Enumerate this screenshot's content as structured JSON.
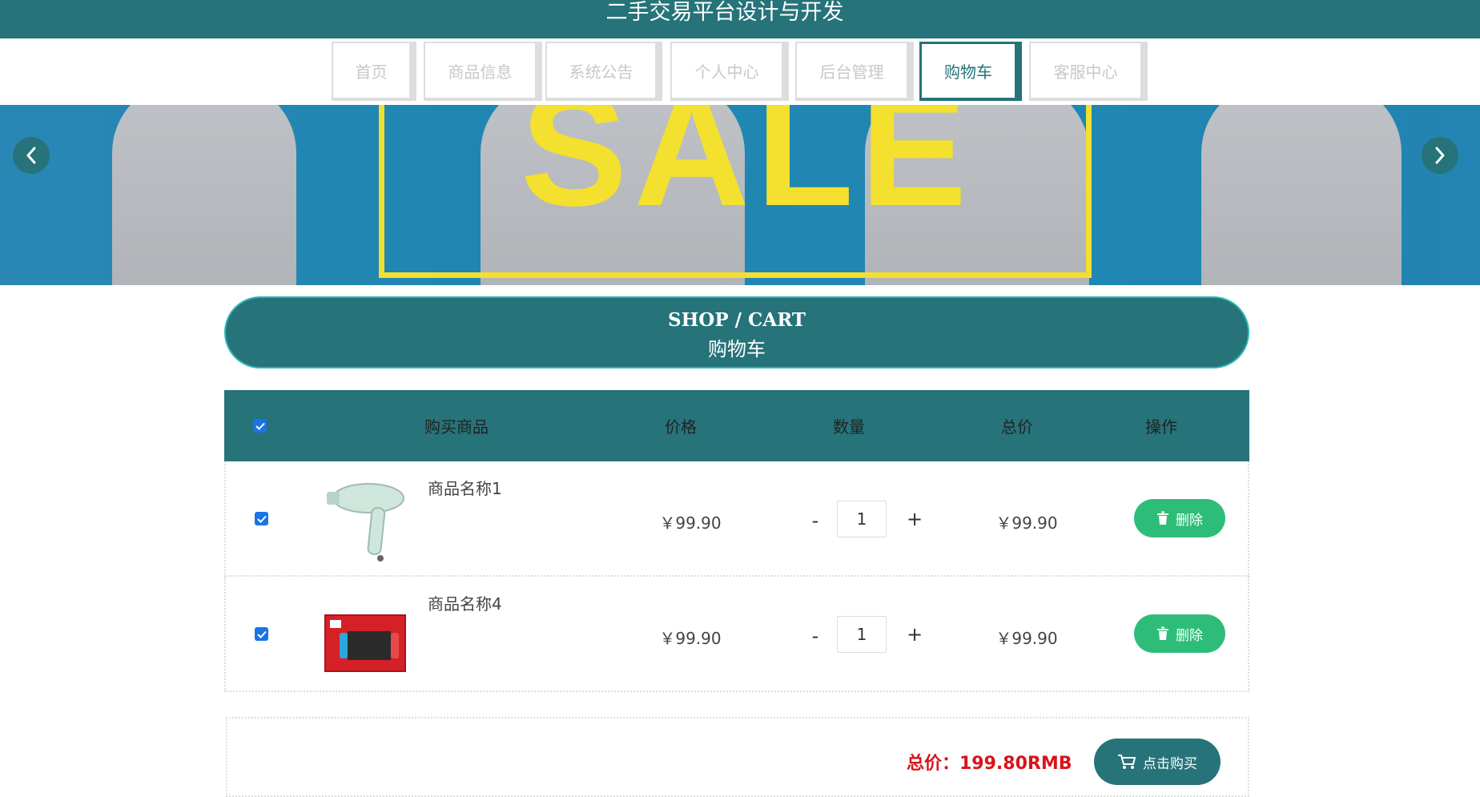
{
  "header": {
    "title": "二手交易平台设计与开发"
  },
  "nav": {
    "items": [
      {
        "label": "首页",
        "active": false
      },
      {
        "label": "商品信息",
        "active": false
      },
      {
        "label": "系统公告",
        "active": false
      },
      {
        "label": "个人中心",
        "active": false
      },
      {
        "label": "后台管理",
        "active": false
      },
      {
        "label": "购物车",
        "active": true
      },
      {
        "label": "客服中心",
        "active": false
      }
    ]
  },
  "banner": {
    "text": "SALE"
  },
  "section": {
    "title_en": "SHOP / CART",
    "title_cn": "购物车"
  },
  "table": {
    "select_all_checked": true,
    "headers": {
      "product": "购买商品",
      "price": "价格",
      "quantity": "数量",
      "total": "总价",
      "action": "操作"
    },
    "rows": [
      {
        "checked": true,
        "name": "商品名称1",
        "image": "hair-dryer",
        "price": "￥99.90",
        "minus": "-",
        "qty": "1",
        "plus": "+",
        "total": "￥99.90",
        "delete_label": "删除"
      },
      {
        "checked": true,
        "name": "商品名称4",
        "image": "game-console-box",
        "price": "￥99.90",
        "minus": "-",
        "qty": "1",
        "plus": "+",
        "total": "￥99.90",
        "delete_label": "删除"
      }
    ]
  },
  "summary": {
    "total_text": "总价：199.80RMB",
    "buy_label": "点击购买"
  },
  "colors": {
    "primary": "#26737a",
    "accent_border": "#2bb6b8",
    "delete_green": "#2ebd78",
    "total_red": "#d8141a",
    "sale_yellow": "#f4e02e",
    "banner_blue": "#1f86b2"
  }
}
